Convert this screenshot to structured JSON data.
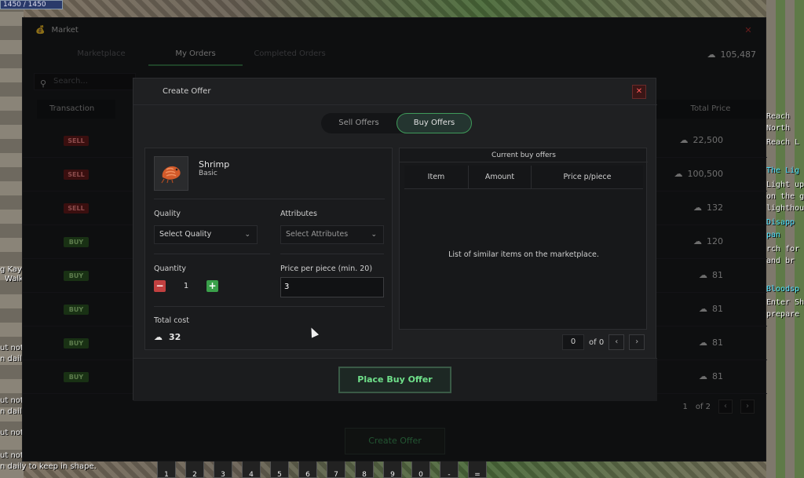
{
  "game": {
    "hp_bar": "1450 / 1450",
    "chat_left": [
      "g Kay",
      "Walk",
      "ut noth",
      "n daily",
      "ut noth",
      "n daily",
      "ut noth",
      "ut noth",
      "n daily to keep in shape."
    ],
    "side_right": [
      "Reach",
      "North",
      "Reach L",
      "The Lig",
      "Light up",
      "on the g",
      "lighthou",
      "Disapp",
      "pan",
      "rch for",
      "and br",
      "Bloodsp",
      "Enter Sh",
      "prepare"
    ],
    "hotbar": [
      "1",
      "2",
      "3",
      "4",
      "5",
      "6",
      "7",
      "8",
      "9",
      "0",
      "-",
      "="
    ]
  },
  "market": {
    "title": "Market",
    "close_icon": "close-icon",
    "tabs": [
      "Marketplace",
      "My Orders",
      "Completed Orders"
    ],
    "active_tab": "My Orders",
    "balance": "105,487",
    "search_placeholder": "Search...",
    "col_transaction": "Transaction",
    "col_total_price": "Total Price",
    "orders": [
      {
        "type": "SELL",
        "price": "22,500"
      },
      {
        "type": "SELL",
        "price": "100,500"
      },
      {
        "type": "SELL",
        "price": "132"
      },
      {
        "type": "BUY",
        "price": "120"
      },
      {
        "type": "BUY",
        "price": "81"
      },
      {
        "type": "BUY",
        "price": "81"
      },
      {
        "type": "BUY",
        "price": "81"
      },
      {
        "type": "BUY",
        "price": "81"
      }
    ],
    "pager": {
      "current": "1",
      "of": "of 2"
    },
    "create_offer_label": "Create Offer"
  },
  "dialog": {
    "title": "Create Offer",
    "toggle": {
      "sell": "Sell Offers",
      "buy": "Buy Offers",
      "active": "buy"
    },
    "item": {
      "name": "Shrimp",
      "tier": "Basic"
    },
    "quality_label": "Quality",
    "quality_value": "Select Quality",
    "attributes_label": "Attributes",
    "attributes_value": "Select Attributes",
    "quantity_label": "Quantity",
    "quantity_value": "1",
    "price_label": "Price per piece (min. 20)",
    "price_value": "3",
    "total_label": "Total cost",
    "total_value": "32",
    "offers_title": "Current buy offers",
    "offers_cols": [
      "Item",
      "Amount",
      "Price p/piece"
    ],
    "offers_empty": "List of similar items on the marketplace.",
    "offers_page": "0",
    "offers_of": "of 0",
    "place_label": "Place Buy Offer"
  },
  "colors": {
    "accent_green": "#3f9a5a",
    "sell_red": "#6a1d1d",
    "buy_green": "#2f5a26"
  }
}
